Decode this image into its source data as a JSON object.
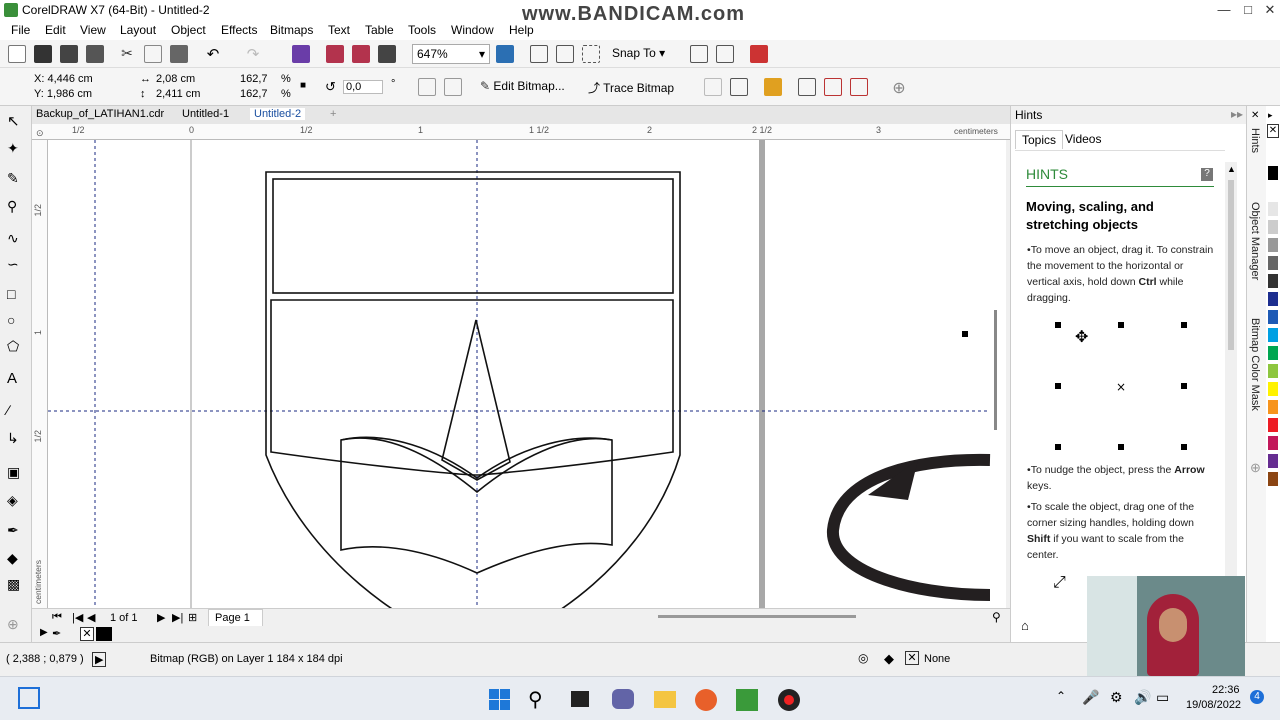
{
  "title_bar": {
    "title": "CorelDRAW X7 (64-Bit) - Untitled-2",
    "watermark": "www.BANDICAM.com"
  },
  "menu": [
    "File",
    "Edit",
    "View",
    "Layout",
    "Object",
    "Effects",
    "Bitmaps",
    "Text",
    "Table",
    "Tools",
    "Window",
    "Help"
  ],
  "toolbar": {
    "zoom": "647%",
    "snap_to": "Snap To"
  },
  "property_bar": {
    "x": "X: 4,446 cm",
    "y": "Y: 1,986 cm",
    "width": "2,08 cm",
    "height": "2,411 cm",
    "scale_x": "162,7",
    "scale_y": "162,7",
    "pct": "%",
    "rotation": "0,0",
    "deg": "°",
    "edit_bitmap": "Edit Bitmap...",
    "trace_bitmap": "Trace Bitmap"
  },
  "doc_tabs": [
    "Backup_of_LATIHAN1.cdr",
    "Untitled-1",
    "Untitled-2"
  ],
  "active_tab": "Untitled-2",
  "ruler": {
    "h_ticks": [
      "1/2",
      "0",
      "1/2",
      "1",
      "1 1/2",
      "2",
      "2 1/2",
      "3"
    ],
    "unit": "centimeters",
    "v_ticks": [
      "1/2",
      "1/2",
      "1"
    ]
  },
  "page_nav": {
    "page_count": "1 of 1",
    "page_tab": "Page 1"
  },
  "status": {
    "coords": "( 2,388 ; 0,879 )",
    "object_info": "Bitmap (RGB) on Layer 1 184 x 184 dpi",
    "fill": "None"
  },
  "hints": {
    "panel_title": "Hints",
    "tabs": [
      "Topics",
      "Videos"
    ],
    "heading": "HINTS",
    "topic_title": "Moving, scaling, and stretching objects",
    "b1": "To move an object, drag it. To constrain the movement to the horizontal or vertical axis, hold down ",
    "b1_key": "Ctrl",
    "b1_end": " while dragging.",
    "b2": "To nudge the object, press the ",
    "b2_key": "Arrow",
    "b2_end": " keys.",
    "b3": "To scale the object, drag one of the corner sizing handles, holding down ",
    "b3_key": "Shift",
    "b3_end": " if you want to scale from the center."
  },
  "side_tabs": [
    "Hints",
    "Object Manager",
    "Bitmap Color Mask"
  ],
  "palette": [
    "#000000",
    "#ffffff",
    "#e6e6e6",
    "#cccccc",
    "#999999",
    "#666666",
    "#333333",
    "#1d2e8f",
    "#1e5ab5",
    "#00a0e3",
    "#00a651",
    "#8dc63f",
    "#fff200",
    "#f7941d",
    "#ed1c24",
    "#c2185b",
    "#662d91",
    "#8b4513"
  ],
  "taskbar": {
    "time": "22:36",
    "date": "19/08/2022",
    "badge": "4"
  }
}
